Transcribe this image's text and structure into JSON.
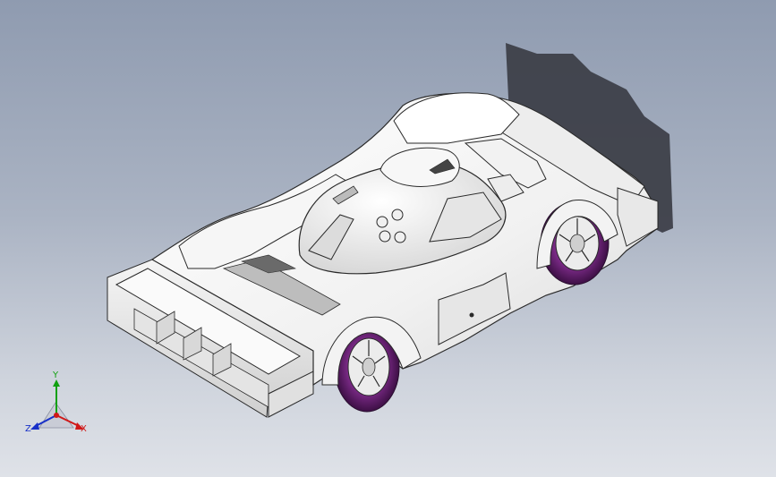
{
  "viewport": {
    "background_top": "#8f9bb0",
    "background_bottom": "#dfe2e8",
    "model_color": "#f4f4f4",
    "model_edge": "#2a2a2a",
    "wheel_tire_color": "#5a1a63",
    "shadow_color": "#3b3d45"
  },
  "triad": {
    "x_label": "X",
    "y_label": "Y",
    "z_label": "Z",
    "x_color": "#d01818",
    "y_color": "#10a010",
    "z_color": "#1830c8"
  }
}
